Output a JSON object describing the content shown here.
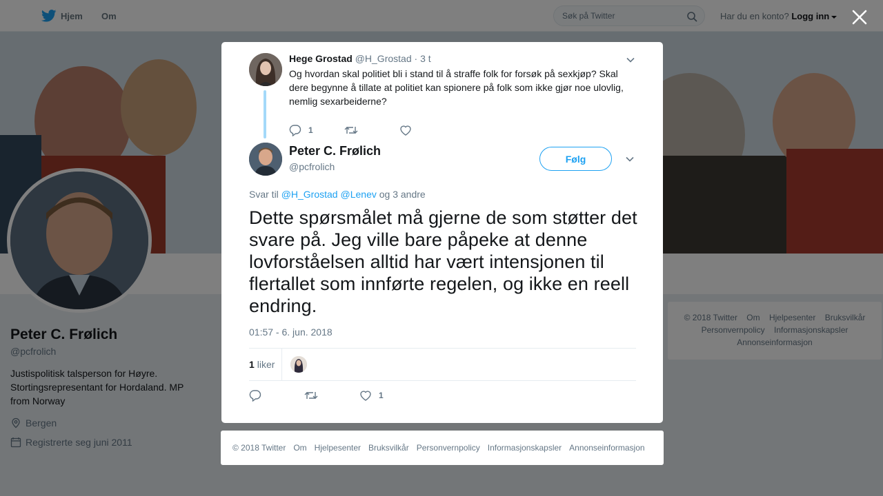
{
  "nav": {
    "home_label": "Hjem",
    "about_label": "Om",
    "search_placeholder": "Søk på Twitter",
    "login_prompt": "Har du en konto?",
    "login_label": "Logg inn"
  },
  "profile": {
    "name": "Peter C. Frølich",
    "handle": "@pcfrolich",
    "bio": "Justispolitisk talsperson for Høyre. Stortingsrepresentant for Hordaland. MP from Norway",
    "location": "Bergen",
    "joined": "Registrerte seg juni 2011"
  },
  "side_footer": {
    "items": [
      "© 2018 Twitter",
      "Om",
      "Hjelpesenter",
      "Bruksvilkår",
      "Personvernpolicy",
      "Informasjonskapsler",
      "Annonseinformasjon"
    ]
  },
  "parent_tweet": {
    "name": "Hege Grostad",
    "handle": "@H_Grostad",
    "time": "· 3 t",
    "text": "Og hvordan skal politiet bli i stand til å straffe folk for forsøk på sexkjøp? Skal dere begynne å tillate at politiet kan spionere på folk som ikke gjør noe ulovlig, nemlig sexarbeiderne?",
    "reply_count": "1"
  },
  "main_tweet": {
    "name": "Peter C. Frølich",
    "handle": "@pcfrolich",
    "follow_label": "Følg",
    "reply_prefix": "Svar til",
    "reply_mention_1": "@H_Grostad",
    "reply_mention_2": "@Lenev",
    "reply_suffix": "og 3 andre",
    "text": "Dette spørsmålet må gjerne de som støtter det svare på. Jeg ville bare påpeke at denne lovforståelsen alltid har vært intensjonen til flertallet som innførte regelen, og ikke en reell endring.",
    "timestamp": "01:57 - 6. jun. 2018",
    "likes_number": "1",
    "likes_label": "liker",
    "like_count": "1"
  },
  "modal_footer": {
    "items": [
      "© 2018 Twitter",
      "Om",
      "Hjelpesenter",
      "Bruksvilkår",
      "Personvernpolicy",
      "Informasjonskapsler",
      "Annonseinformasjon"
    ]
  },
  "colors": {
    "accent": "#1da1f2",
    "thread_line": "#a4d9f9",
    "muted": "#657786"
  }
}
